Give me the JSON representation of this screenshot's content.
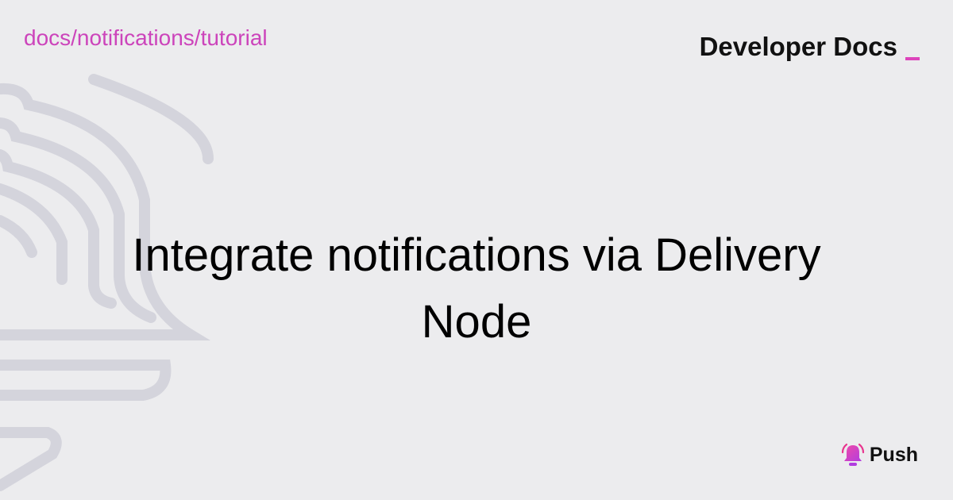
{
  "header": {
    "breadcrumb": "docs/notifications/tutorial",
    "brand_label": "Developer Docs"
  },
  "main": {
    "title": "Integrate notifications via Delivery Node"
  },
  "footer": {
    "logo_name": "Push"
  },
  "icons": {
    "background": "bell-outline-decoration-icon",
    "logo": "push-bell-icon"
  },
  "colors": {
    "background": "#ececee",
    "accent": "#cc44bb",
    "text": "#111111",
    "decoration": "#d4d4dc"
  }
}
